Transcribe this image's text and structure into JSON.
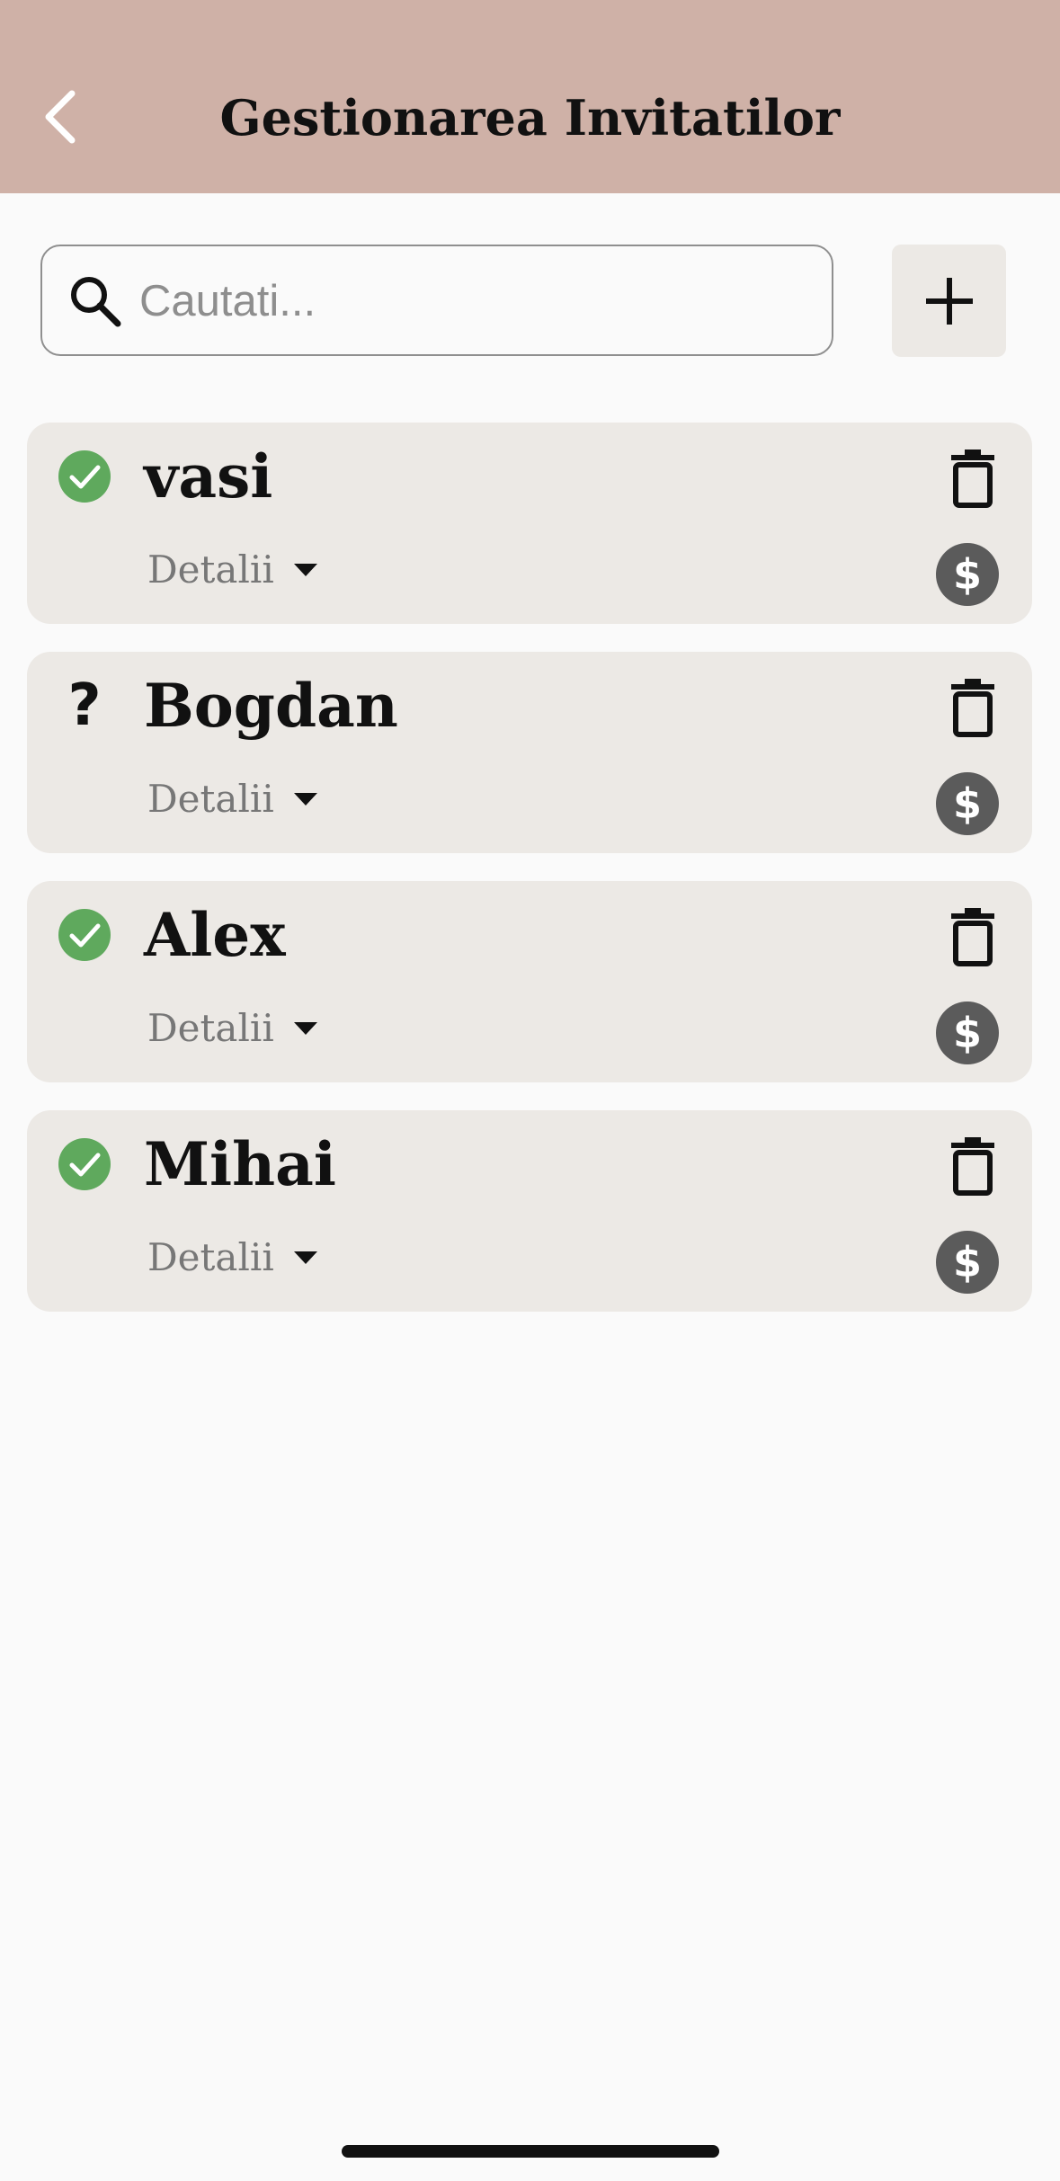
{
  "header": {
    "title": "Gestionarea Invitatilor"
  },
  "search": {
    "placeholder": "Cautati...",
    "value": ""
  },
  "guests": [
    {
      "name": "vasi",
      "status": "confirmed",
      "details_label": "Detalii"
    },
    {
      "name": "Bogdan",
      "status": "unknown",
      "status_text": "?",
      "details_label": "Detalii"
    },
    {
      "name": "Alex",
      "status": "confirmed",
      "details_label": "Detalii"
    },
    {
      "name": "Mihai",
      "status": "confirmed",
      "details_label": "Detalii"
    }
  ],
  "colors": {
    "header_bg": "#cfb1a7",
    "card_bg": "#ece9e5",
    "confirmed_green": "#5fa95d",
    "payment_icon_bg": "#5b5b5b"
  },
  "icons": {
    "back": "chevron-left-icon",
    "search": "search-icon",
    "add": "plus-icon",
    "confirmed": "check-circle-icon",
    "delete": "trash-icon",
    "expand": "caret-down-icon",
    "payment": "dollar-icon"
  }
}
